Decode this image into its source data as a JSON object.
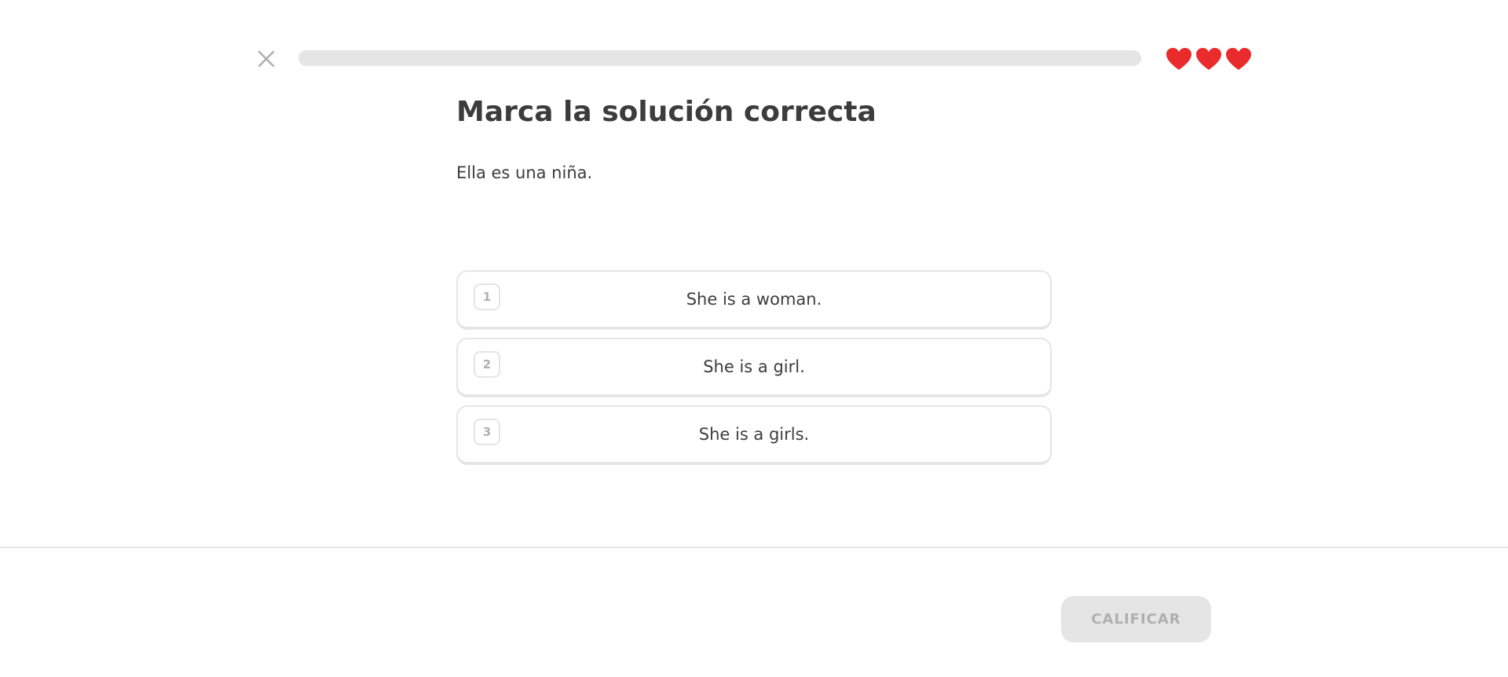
{
  "header": {
    "close_icon": "close-icon",
    "progress_fraction": 0.0,
    "progress_color": "#58cc02",
    "hearts": {
      "count": 3,
      "icon": "heart-icon",
      "color": "#ea2b2b"
    }
  },
  "main": {
    "title": "Marca la solución correcta",
    "prompt": "Ella es una niña.",
    "options": [
      {
        "key": "1",
        "text": "She is a woman."
      },
      {
        "key": "2",
        "text": "She is a girl."
      },
      {
        "key": "3",
        "text": "She is a girls."
      }
    ]
  },
  "footer": {
    "check_label": "CALIFICAR",
    "check_disabled": true
  }
}
